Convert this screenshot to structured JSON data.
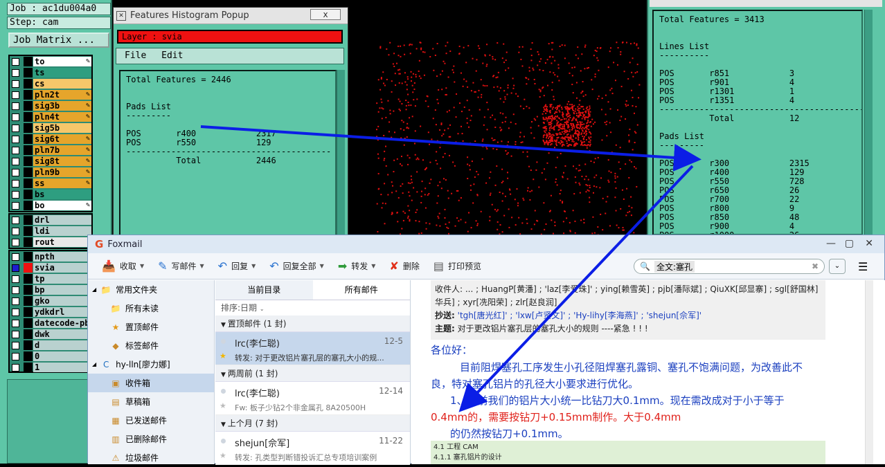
{
  "left_panel": {
    "job": "Job : ac1du004a0",
    "step": "Step: cam",
    "matrix_button": "Job Matrix ...",
    "layers": [
      {
        "name": "to",
        "color": "#ffffff",
        "pen": true,
        "checked": false
      },
      {
        "name": "ts",
        "color": "#2e9e80",
        "pen": false,
        "checked": false
      },
      {
        "name": "cs",
        "color": "#f6c76a",
        "pen": false,
        "checked": false
      },
      {
        "name": "pln2t",
        "color": "#e6a52b",
        "pen": true,
        "checked": false
      },
      {
        "name": "sig3b",
        "color": "#e6a52b",
        "pen": true,
        "checked": false
      },
      {
        "name": "pln4t",
        "color": "#e6a52b",
        "pen": true,
        "checked": false
      },
      {
        "name": "sig5b",
        "color": "#f6c76a",
        "pen": false,
        "checked": false
      },
      {
        "name": "sig6t",
        "color": "#e6a52b",
        "pen": true,
        "checked": false
      },
      {
        "name": "pln7b",
        "color": "#e6a52b",
        "pen": true,
        "checked": false
      },
      {
        "name": "sig8t",
        "color": "#e6a52b",
        "pen": true,
        "checked": false
      },
      {
        "name": "pln9b",
        "color": "#e6a52b",
        "pen": true,
        "checked": false
      },
      {
        "name": "ss",
        "color": "#e6a52b",
        "pen": true,
        "checked": false
      },
      {
        "name": "bs",
        "color": "#2e9e80",
        "pen": false,
        "checked": false
      },
      {
        "name": "bo",
        "color": "#ffffff",
        "pen": true,
        "checked": false
      }
    ],
    "drill_layers": [
      {
        "name": "drl",
        "color": "#b9d1cf",
        "checked": false
      },
      {
        "name": "ldi",
        "color": "#b9d1cf",
        "checked": false
      },
      {
        "name": "rout",
        "color": "#e8e8e8",
        "checked": false
      }
    ],
    "other_layers": [
      {
        "name": "npth",
        "color": "#b9d1cf",
        "checked": false,
        "swatch": "#000"
      },
      {
        "name": "svia",
        "color": "#b9d1cf",
        "checked": true,
        "swatch": "#ee1111"
      },
      {
        "name": "tp",
        "color": "#b9d1cf",
        "checked": false,
        "swatch": "#000"
      },
      {
        "name": "bp",
        "color": "#b9d1cf",
        "checked": false,
        "swatch": "#000"
      },
      {
        "name": "gko",
        "color": "#b9d1cf",
        "checked": false,
        "swatch": "#000"
      },
      {
        "name": "ydkdrl",
        "color": "#b9d1cf",
        "checked": false,
        "swatch": "#000"
      },
      {
        "name": "datecode-pb",
        "color": "#b9d1cf",
        "checked": false,
        "swatch": "#000"
      },
      {
        "name": "dwk",
        "color": "#b9d1cf",
        "checked": false,
        "swatch": "#000"
      },
      {
        "name": "d",
        "color": "#b9d1cf",
        "checked": false,
        "swatch": "#000"
      },
      {
        "name": "0",
        "color": "#b9d1cf",
        "checked": false,
        "swatch": "#000"
      },
      {
        "name": "1",
        "color": "#b9d1cf",
        "checked": false,
        "swatch": "#000"
      }
    ]
  },
  "popup": {
    "title": "Features Histogram Popup",
    "close_label": "x",
    "layer_label": "Layer :  svia",
    "menu": [
      "File",
      "Edit"
    ],
    "text": "Total Features = 2446\n\n\nPads List\n---------\n\nPOS       r400            2317\nPOS       r550            129\n-----------------------------------------\n          Total           2446"
  },
  "right_panel": {
    "text": "Total Features = 3413\n\n\nLines List\n----------\n\nPOS       r851            3\nPOS       r901            4\nPOS       r1301           1\nPOS       r1351           4\n-----------------------------------------\n          Total           12\n\nPads List\n---------\n\nPOS       r300            2315\nPOS       r400            129\nPOS       r550            728\nPOS       r650            26\nPOS       r700            22\nPOS       r800            9\nPOS       r850            48\nPOS       r900            4\nPOS       r1000           26"
  },
  "foxmail": {
    "title": "Foxmail",
    "toolbar": [
      {
        "label": "收取",
        "icon": "inbox-receive-icon",
        "glyph": "📥",
        "dd": true
      },
      {
        "label": "写邮件",
        "icon": "compose-feather-icon",
        "glyph": "✎",
        "dd": true
      },
      {
        "label": "回复",
        "icon": "reply-arrow-icon",
        "glyph": "↶",
        "dd": true
      },
      {
        "label": "回复全部",
        "icon": "reply-all-icon",
        "glyph": "↶",
        "dd": true
      },
      {
        "label": "转发",
        "icon": "forward-arrow-icon",
        "glyph": "➡",
        "dd": true
      },
      {
        "label": "删除",
        "icon": "delete-x-icon",
        "glyph": "✘",
        "dd": false
      },
      {
        "label": "打印预览",
        "icon": "print-icon",
        "glyph": "▤",
        "dd": false
      }
    ],
    "search_text": "全文:塞孔",
    "sidebar": [
      {
        "label": "常用文件夹",
        "type": "group",
        "icon": "folder-icon"
      },
      {
        "label": "所有未读",
        "type": "item",
        "icon": "folder-icon"
      },
      {
        "label": "置顶邮件",
        "type": "item",
        "icon": "star-icon"
      },
      {
        "label": "标签邮件",
        "type": "item",
        "icon": "tag-icon"
      },
      {
        "label": "hy-lln[廖力娜]",
        "type": "group",
        "icon": "account-icon"
      },
      {
        "label": "收件箱",
        "type": "item",
        "icon": "inbox-icon",
        "selected": true
      },
      {
        "label": "草稿箱",
        "type": "item",
        "icon": "draft-icon"
      },
      {
        "label": "已发送邮件",
        "type": "item",
        "icon": "sent-icon"
      },
      {
        "label": "已删除邮件",
        "type": "item",
        "icon": "trash-icon"
      },
      {
        "label": "垃圾邮件",
        "type": "item",
        "icon": "junk-icon"
      }
    ],
    "list_tabs": [
      "当前目录",
      "所有邮件"
    ],
    "sort_label": "排序:日期",
    "groups": [
      {
        "label": "置顶邮件 (1 封)",
        "items": [
          {
            "from": "lrc(李仁聪)",
            "date": "12-5",
            "subj": "转发: 对于更改铝片塞孔层的塞孔大小的规...",
            "selected": true
          }
        ]
      },
      {
        "label": "两周前 (1 封)",
        "items": [
          {
            "from": "lrc(李仁聪)",
            "date": "12-14",
            "subj": "Fw: 板子少钻2个非金属孔 8A20500H",
            "selected": false
          }
        ]
      },
      {
        "label": "上个月 (7 封)",
        "items": [
          {
            "from": "shejun[佘军]",
            "date": "11-22",
            "subj": "转发: 孔类型判断错投诉汇总专项培训案例",
            "selected": false
          }
        ]
      }
    ],
    "header": {
      "line1": "收件人: ... ; HuangP[黄潘] ; 'laz[李爱珠]' ; ying[赖雪英] ; pjb[潘际斌] ; QiuXK[邱显寨] ; sgl[舒国林] ; whb[王",
      "line2": "华兵] ; xyr[冼阳荣] ; zlr[赵良润]",
      "cc_label": "抄送:",
      "cc": "'tgh[唐光红]' ; 'lxw[卢贤文]' ; 'Hy-lihy[李海燕]' ; 'shejun[佘军]'",
      "subject_label": "主题:",
      "subject": "对于更改铝片塞孔层的塞孔大小的规则 ----紧急 ! ! !"
    },
    "body": {
      "greeting": "各位好：",
      "p1a": "目前阻焊塞孔工序发生小孔径阻焊塞孔露铜、塞孔不饱满问题，为改善此不",
      "p1b": "良，特对塞孔铝片的孔径大小要求进行优化。",
      "p2a": "1、之前我们的铝片大小统一比钻刀大0.1mm。现在需改成对于小于等于",
      "p2b": "0.4mm的，需要按钻刀+0.15mm制作。大于0.4mm",
      "p2c": "的仍然按钻刀+0.1mm。"
    },
    "doc_lines": [
      "4.1 工程 CAM",
      "4.1.1 塞孔铝片的设计"
    ]
  }
}
